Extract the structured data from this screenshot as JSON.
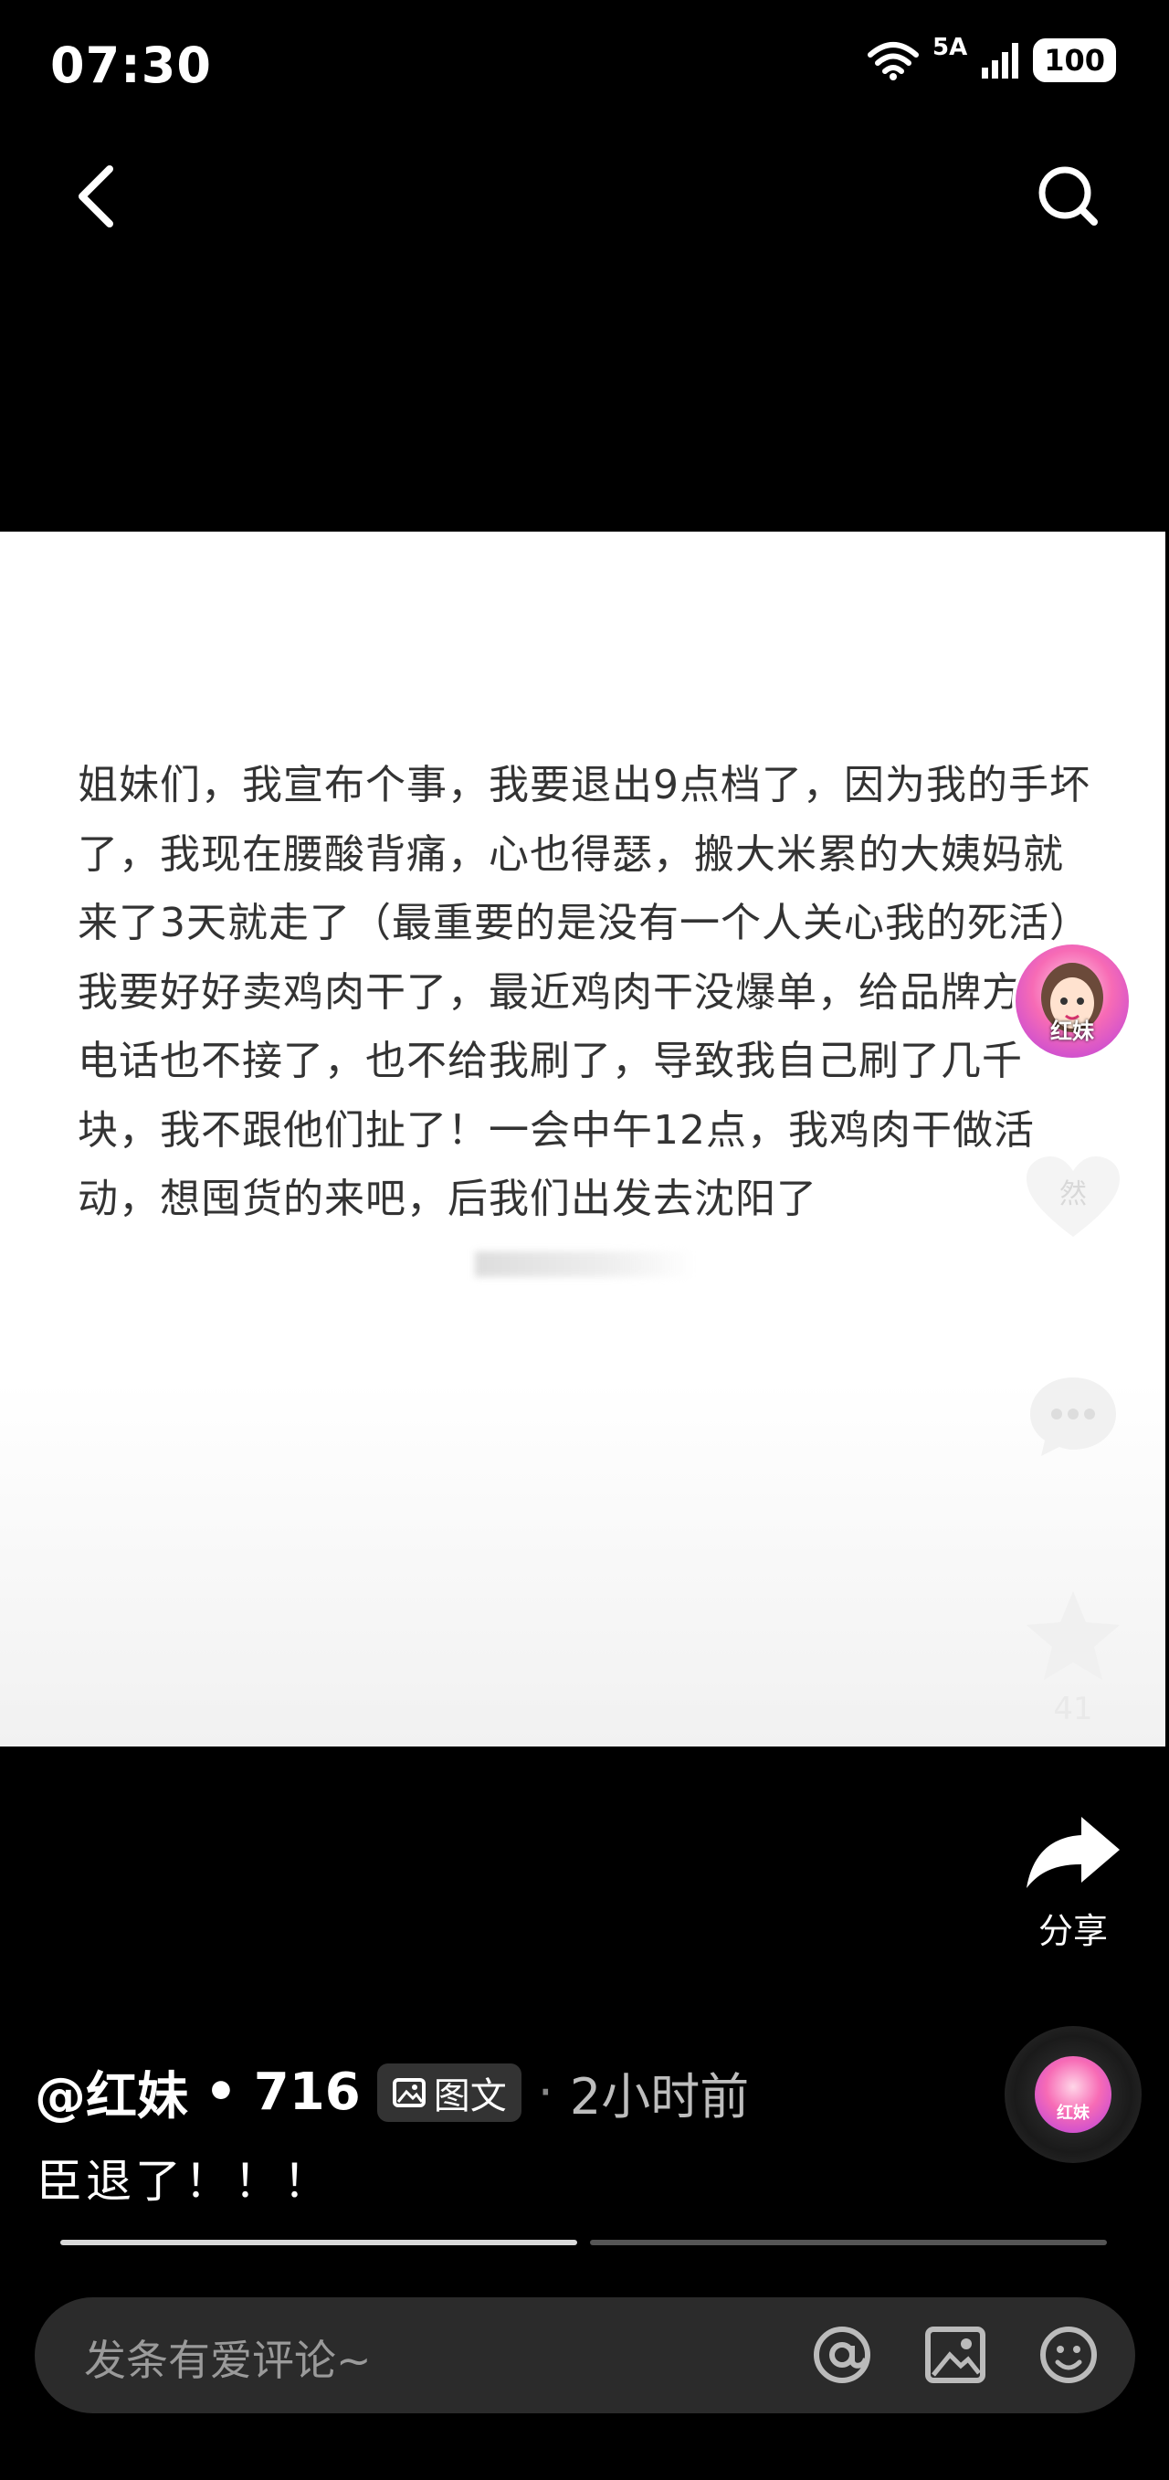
{
  "status_bar": {
    "time": "07:30",
    "network": "5A",
    "battery": "100"
  },
  "post": {
    "body": "姐妹们，我宣布个事，我要退出9点档了，因为我的手坏了，我现在腰酸背痛，心也得瑟，搬大米累的大姨妈就来了3天就走了（最重要的是没有一个人关心我的死活）我要好好卖鸡肉干了，最近鸡肉干没爆单，给品牌方打电话也不接了，也不给我刷了，导致我自己刷了几千块，我不跟他们扯了！一会中午12点，我鸡肉干做活动，想囤货的来吧，后我们出发去沈阳了"
  },
  "rail": {
    "avatar_label": "红妹",
    "like_icon_text": "然",
    "collect_count": "41",
    "share_label": "分享"
  },
  "meta": {
    "author": "@红妹",
    "separator": "•",
    "likes": "716",
    "type_badge": "图文",
    "dot": "·",
    "time_ago": "2小时前",
    "caption": "臣退了！！！"
  },
  "progress": {
    "segments": 2,
    "active_index": 0
  },
  "comment": {
    "placeholder": "发条有爱评论~"
  },
  "colors": {
    "background": "#000000",
    "card": "#ffffff",
    "text_dark": "#333333",
    "avatar_accent": "#f76bb5"
  }
}
